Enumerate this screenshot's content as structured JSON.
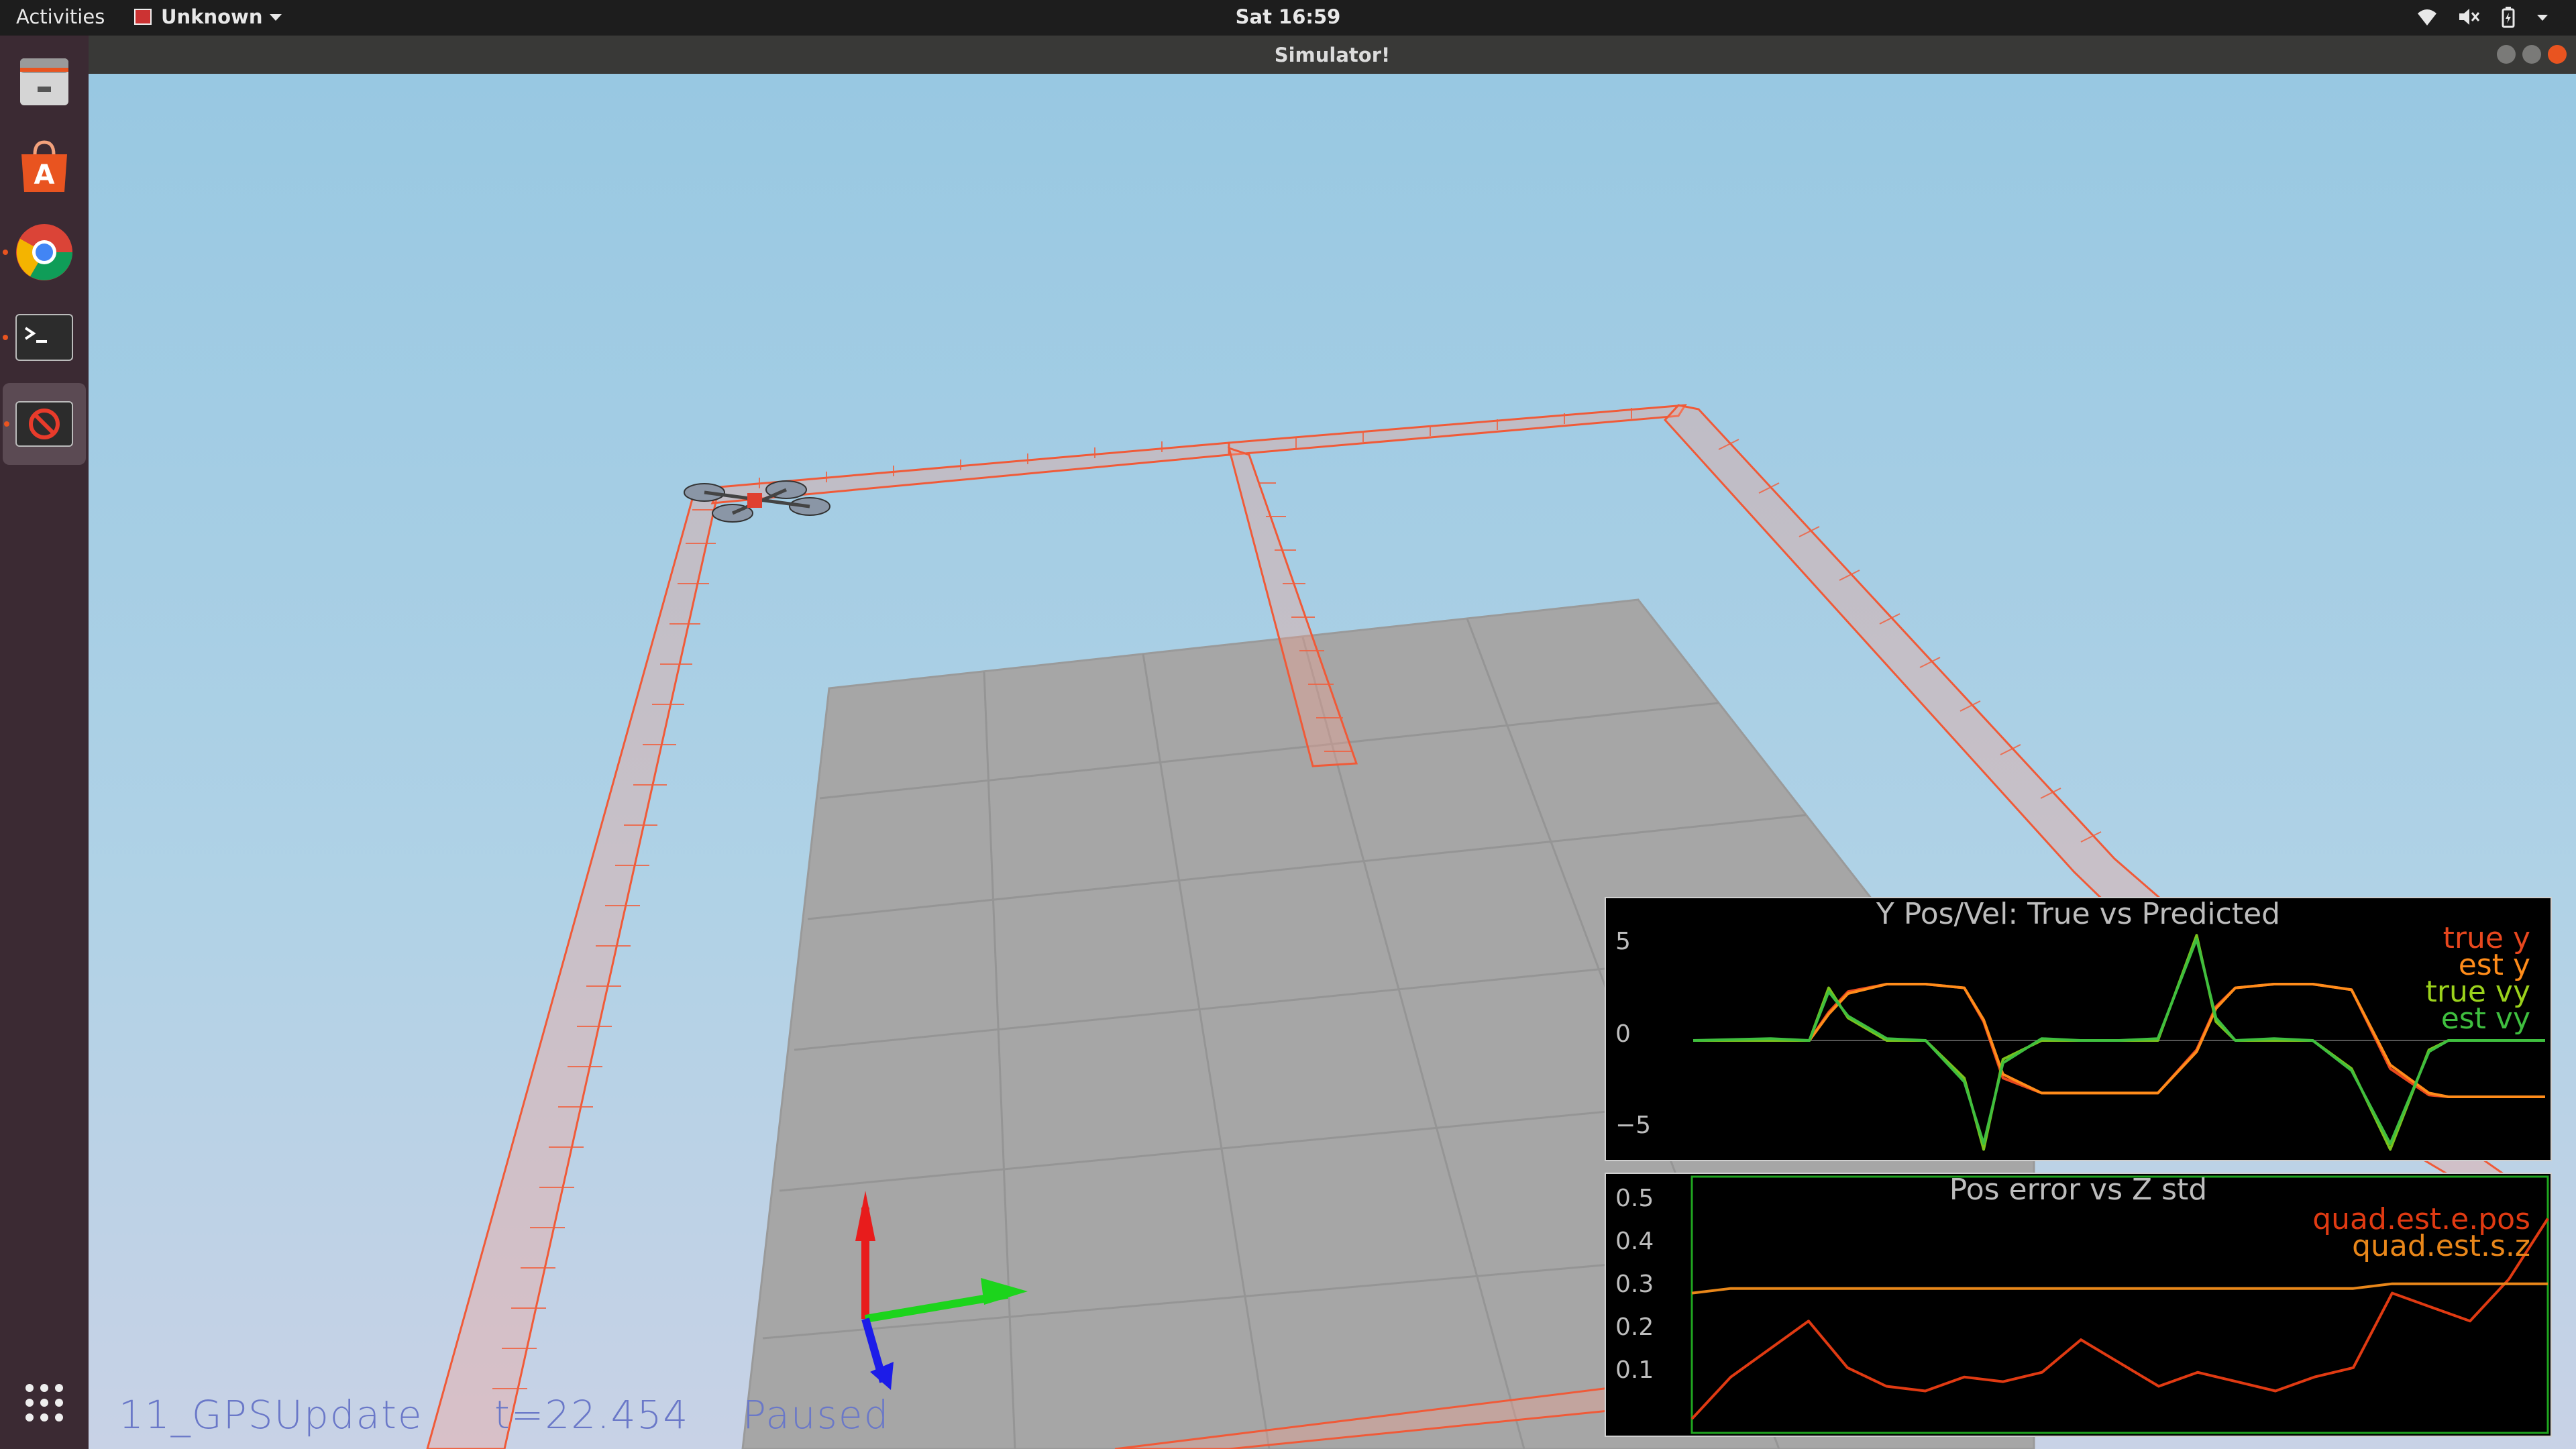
{
  "topbar": {
    "activities": "Activities",
    "app_name": "Unknown",
    "clock": "Sat 16:59"
  },
  "window": {
    "title": "Simulator!"
  },
  "dock": {
    "items": [
      "files-icon",
      "software-icon",
      "chrome-icon",
      "terminal-icon",
      "simulator-icon"
    ]
  },
  "viewport": {
    "scenario": "11_GPSUpdate",
    "time": "t=22.454",
    "state": "Paused"
  },
  "colors": {
    "true_y": "#e8471e",
    "est_y": "#ff8c1a",
    "true_vy": "#7bc21c",
    "est_vy": "#3fbf3f",
    "error": "#e03a12",
    "std": "#e9871a"
  },
  "plot1": {
    "title": "Y Pos/Vel: True vs Predicted",
    "legend": [
      "true y",
      "est y",
      "true vy",
      "est vy"
    ]
  },
  "plot2": {
    "title": "Pos error vs Z std",
    "legend": [
      "quad.est.e.pos",
      "quad.est.s.z"
    ]
  },
  "chart_data": [
    {
      "type": "line",
      "title": "Y Pos/Vel: True vs Predicted",
      "y_ticks": [
        "5",
        "0",
        "−5"
      ],
      "ylim": [
        -6,
        6.5
      ],
      "x": [
        0,
        2,
        3,
        3.5,
        4,
        5,
        6,
        7,
        7.5,
        8,
        9,
        10,
        11,
        12,
        13,
        13.5,
        14,
        15,
        16,
        17,
        18,
        19,
        19.5,
        20,
        21,
        22
      ],
      "series": [
        {
          "name": "true y",
          "values": [
            0,
            0,
            0,
            1.5,
            2.6,
            3,
            3,
            2.8,
            1,
            -2,
            -2.8,
            -2.8,
            -2.8,
            -2.8,
            -0.5,
            1.8,
            2.8,
            3,
            3,
            2.7,
            -1.5,
            -2.9,
            -3,
            -3,
            -3,
            -3
          ]
        },
        {
          "name": "est y",
          "values": [
            0,
            0,
            0,
            1.4,
            2.5,
            3,
            3,
            2.8,
            1.1,
            -1.8,
            -2.8,
            -2.8,
            -2.8,
            -2.8,
            -0.6,
            1.7,
            2.8,
            3,
            3,
            2.7,
            -1.3,
            -2.8,
            -3,
            -3,
            -3,
            -3
          ]
        },
        {
          "name": "true vy",
          "values": [
            0,
            0,
            0,
            2.8,
            1.2,
            0,
            0,
            -2,
            -5.8,
            -1,
            0,
            0,
            0,
            0,
            5.6,
            1,
            0,
            0,
            0,
            -1.5,
            -5.8,
            -0.5,
            0,
            0,
            0,
            0
          ]
        },
        {
          "name": "est vy",
          "values": [
            0,
            0.1,
            0,
            2.6,
            1.3,
            0.1,
            0,
            -2.2,
            -5.5,
            -1.2,
            0.1,
            0,
            0,
            0.1,
            5.4,
            1.2,
            0,
            0.1,
            0,
            -1.6,
            -5.5,
            -0.6,
            0,
            0,
            0,
            0
          ]
        }
      ]
    },
    {
      "type": "line",
      "title": "Pos error vs Z std",
      "y_ticks": [
        "0.5",
        "0.4",
        "0.3",
        "0.2",
        "0.1"
      ],
      "ylim": [
        0,
        0.55
      ],
      "x": [
        0,
        1,
        2,
        3,
        4,
        5,
        6,
        7,
        8,
        9,
        10,
        11,
        12,
        13,
        14,
        15,
        16,
        17,
        18,
        19,
        20,
        21,
        22
      ],
      "series": [
        {
          "name": "quad.est.e.pos",
          "values": [
            0.03,
            0.12,
            0.18,
            0.24,
            0.14,
            0.1,
            0.09,
            0.12,
            0.11,
            0.13,
            0.2,
            0.15,
            0.1,
            0.13,
            0.11,
            0.09,
            0.12,
            0.14,
            0.3,
            0.27,
            0.24,
            0.33,
            0.46
          ]
        },
        {
          "name": "quad.est.s.z",
          "values": [
            0.3,
            0.31,
            0.31,
            0.31,
            0.31,
            0.31,
            0.31,
            0.31,
            0.31,
            0.31,
            0.31,
            0.31,
            0.31,
            0.31,
            0.31,
            0.31,
            0.31,
            0.31,
            0.32,
            0.32,
            0.32,
            0.32,
            0.32
          ]
        }
      ]
    }
  ]
}
